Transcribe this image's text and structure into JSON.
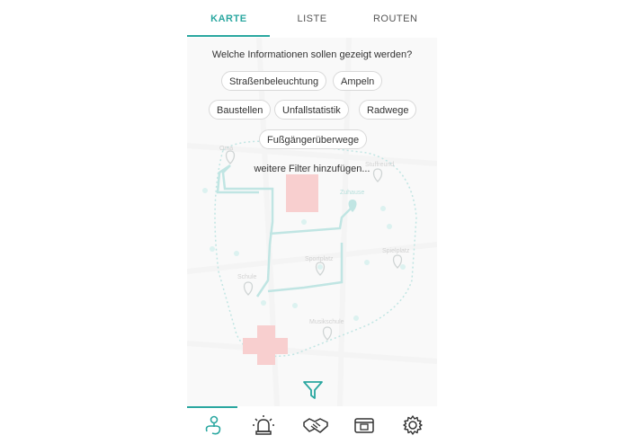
{
  "tabs": [
    {
      "label": "KARTE",
      "active": true
    },
    {
      "label": "LISTE",
      "active": false
    },
    {
      "label": "ROUTEN",
      "active": false
    }
  ],
  "filter_panel": {
    "question": "Welche Informationen sollen gezeigt werden?",
    "chips": [
      "Straßenbeleuchtung",
      "Ampeln",
      "Baustellen",
      "Unfallstatistik",
      "Radwege",
      "Fußgängerüberwege"
    ],
    "more_filters": "weitere Filter hinzufügen..."
  },
  "map_labels": {
    "oma": "Oma",
    "stuffreund": "Stuffreund",
    "zuhause": "Zuhause",
    "sportplatz": "Sportplatz",
    "spielplatz": "Spielplatz",
    "schule": "Schule",
    "musikschule": "Musikschule"
  },
  "bottom_nav": {
    "items": [
      "map-route-icon",
      "alarm-light-icon",
      "handshake-icon",
      "wallet-icon",
      "gear-icon"
    ],
    "active": 0
  },
  "colors": {
    "accent": "#2aa7a0",
    "route": "#9fd8d4",
    "block_pink": "#f4b6b6"
  }
}
